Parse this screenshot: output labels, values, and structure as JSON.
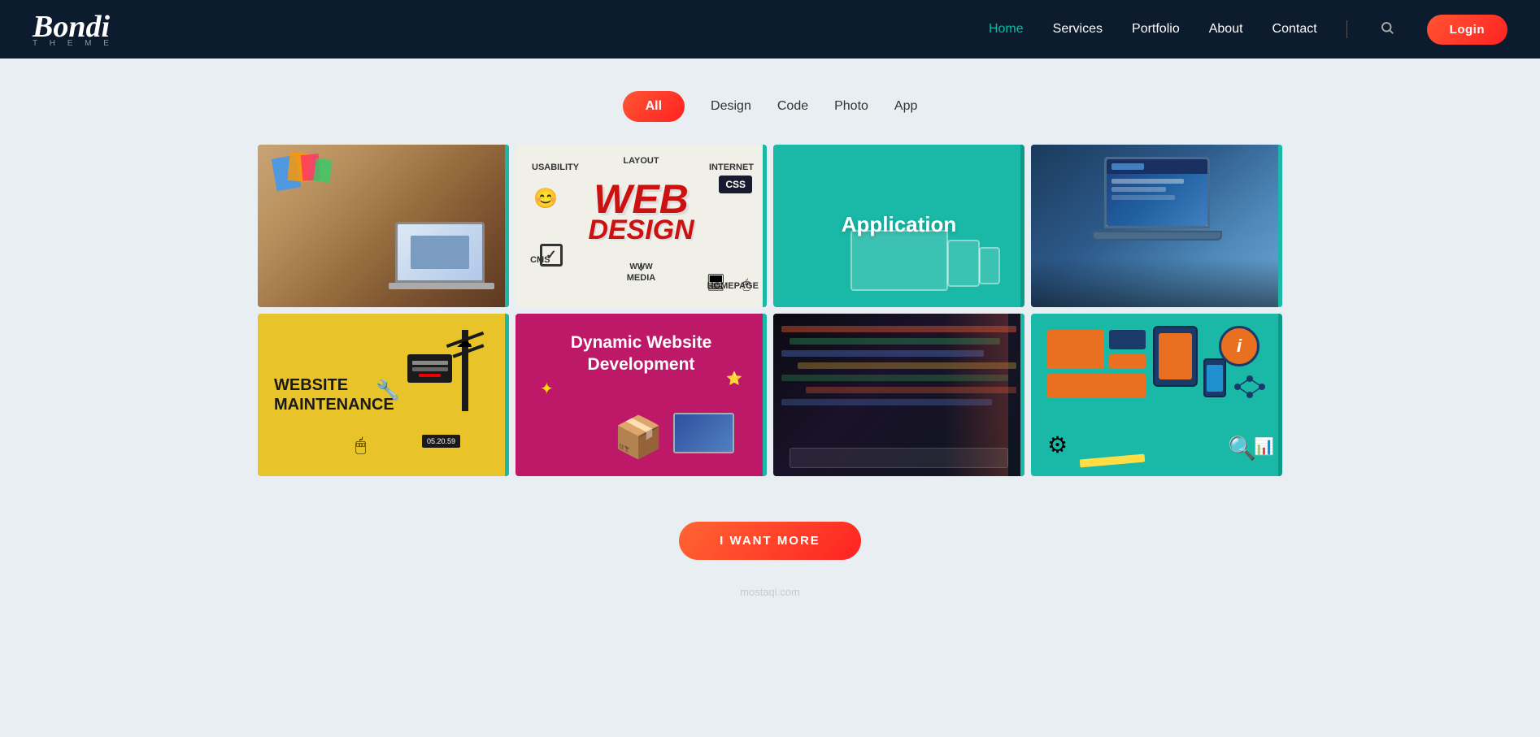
{
  "header": {
    "logo": {
      "main": "Bondi",
      "sub": "T H E M E"
    },
    "nav": {
      "home": "Home",
      "services": "Services",
      "portfolio": "Portfolio",
      "about": "About",
      "contact": "Contact"
    },
    "login_label": "Login"
  },
  "filters": {
    "all": "All",
    "design": "Design",
    "code": "Code",
    "photo": "Photo",
    "app": "App"
  },
  "portfolio": {
    "row1": [
      {
        "id": "card-1",
        "type": "photo",
        "bg": "desk"
      },
      {
        "id": "card-2",
        "type": "design",
        "label": "WEB DESIGN",
        "bg": "white"
      },
      {
        "id": "card-3",
        "type": "app",
        "label": "Application",
        "bg": "teal"
      },
      {
        "id": "card-4",
        "type": "photo",
        "bg": "laptop"
      }
    ],
    "row2": [
      {
        "id": "card-5",
        "type": "design",
        "label": "WEBSITE MAINTENANCE",
        "bg": "yellow"
      },
      {
        "id": "card-6",
        "type": "code",
        "label": "Dynamic Website Development",
        "bg": "pink"
      },
      {
        "id": "card-7",
        "type": "photo",
        "bg": "coding"
      },
      {
        "id": "card-8",
        "type": "app",
        "bg": "teal2"
      }
    ]
  },
  "more_button": "I WANT MORE",
  "watermark": "mostaqi.com",
  "colors": {
    "nav_active": "#00bfa5",
    "header_bg": "#0d1b2e",
    "teal": "#1ab8a6",
    "login_bg": "#ff4444",
    "filter_active_bg": "#ff5533",
    "yellow": "#e8c42a",
    "pink": "#be1868"
  }
}
